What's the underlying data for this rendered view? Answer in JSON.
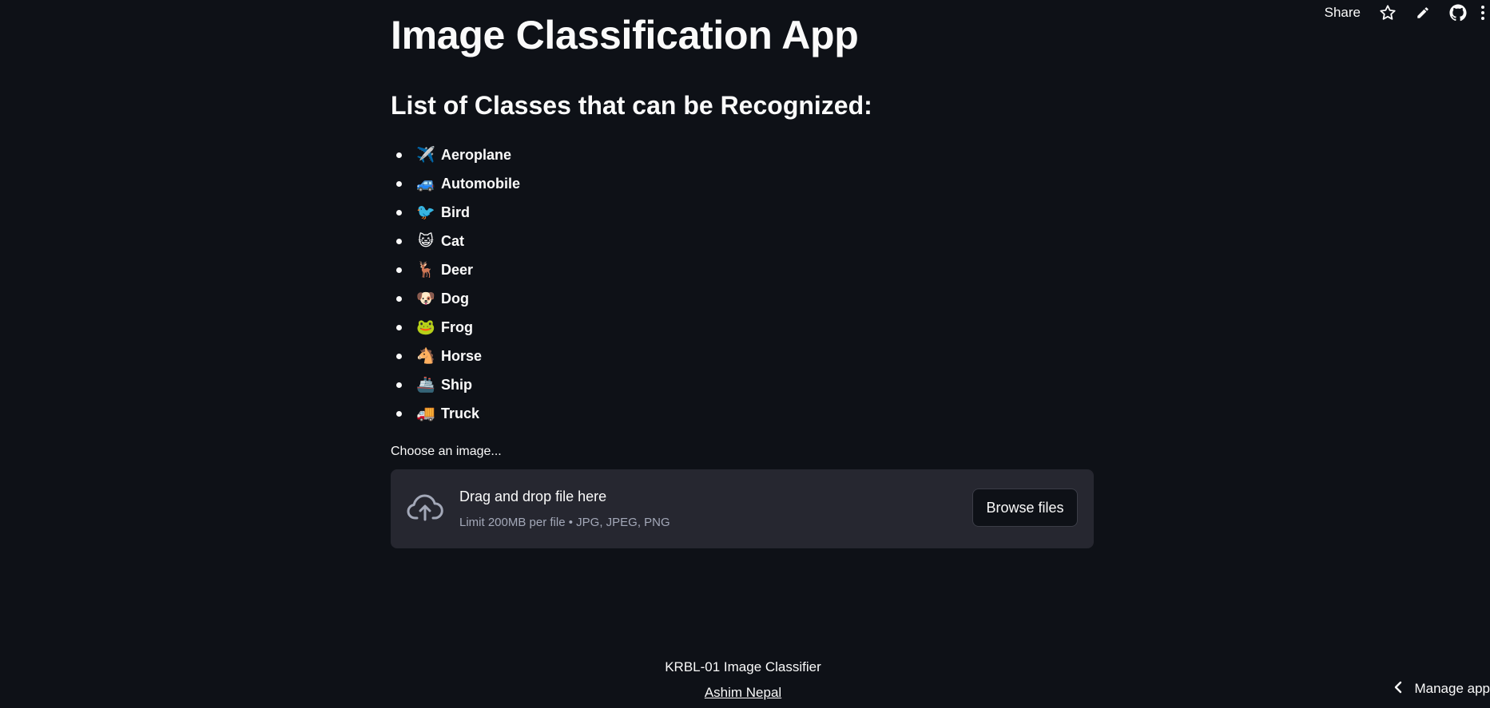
{
  "toolbar": {
    "share_label": "Share",
    "icons": [
      "star-icon",
      "pencil-icon",
      "github-icon",
      "more-vertical-icon"
    ]
  },
  "main": {
    "title": "Image Classification App",
    "subtitle": "List of Classes that can be Recognized:",
    "classes": [
      {
        "emoji": "✈️",
        "label": "Aeroplane"
      },
      {
        "emoji": "🚙",
        "label": "Automobile"
      },
      {
        "emoji": "🐦",
        "label": "Bird"
      },
      {
        "emoji": "😺",
        "label": "Cat"
      },
      {
        "emoji": "🦌",
        "label": "Deer"
      },
      {
        "emoji": "🐶",
        "label": "Dog"
      },
      {
        "emoji": "🐸",
        "label": "Frog"
      },
      {
        "emoji": "🐴",
        "label": "Horse"
      },
      {
        "emoji": "🚢",
        "label": "Ship"
      },
      {
        "emoji": "🚚",
        "label": "Truck"
      }
    ],
    "uploader": {
      "label": "Choose an image...",
      "drag_text": "Drag and drop file here",
      "limit_text": "Limit 200MB per file • JPG, JPEG, PNG",
      "browse_label": "Browse files"
    }
  },
  "footer": {
    "text": "KRBL-01 Image Classifier",
    "author": "Ashim Nepal"
  },
  "manage_app": {
    "label": "Manage app"
  },
  "colors": {
    "background": "#0e1117",
    "dropzone": "#262730",
    "text": "#fafafa",
    "muted": "#a3a8b8"
  }
}
